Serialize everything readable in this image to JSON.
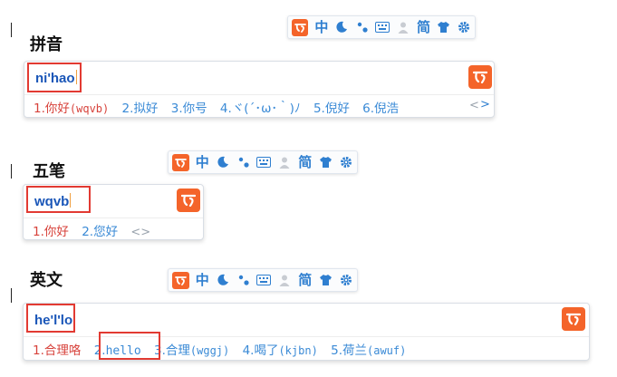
{
  "toolbar": {
    "mode": "中",
    "script": "简"
  },
  "pinyin": {
    "label": "拼音",
    "composition": "ni'hao",
    "candidates": [
      {
        "index": "1.",
        "text": "你好",
        "code": "(wqvb)"
      },
      {
        "index": "2.",
        "text": "拟好",
        "code": ""
      },
      {
        "index": "3.",
        "text": "你号",
        "code": ""
      },
      {
        "index": "4.",
        "text": "ヾ(´･ω･｀)ﾉ",
        "code": ""
      },
      {
        "index": "5.",
        "text": "倪好",
        "code": ""
      },
      {
        "index": "6.",
        "text": "倪浩",
        "code": ""
      }
    ],
    "prev": "<",
    "next": ">"
  },
  "wubi": {
    "label": "五笔",
    "composition": "wqvb",
    "candidates": [
      {
        "index": "1.",
        "text": "你好",
        "code": ""
      },
      {
        "index": "2.",
        "text": "您好",
        "code": ""
      }
    ],
    "nav": "<>"
  },
  "english": {
    "label": "英文",
    "composition": "he'l'lo",
    "candidates": [
      {
        "index": "1.",
        "text": "合理咯",
        "code": ""
      },
      {
        "index": "2.",
        "text": "hello",
        "code": ""
      },
      {
        "index": "3.",
        "text": "合理",
        "code": "(wggj)"
      },
      {
        "index": "4.",
        "text": "喝了",
        "code": "(kjbn)"
      },
      {
        "index": "5.",
        "text": "荷兰",
        "code": "(awuf)"
      }
    ]
  },
  "colors": {
    "brand": "#f4642a",
    "accent": "#2f7fd0",
    "highlight_box": "#e23a32",
    "first_candidate": "#d7423b"
  }
}
